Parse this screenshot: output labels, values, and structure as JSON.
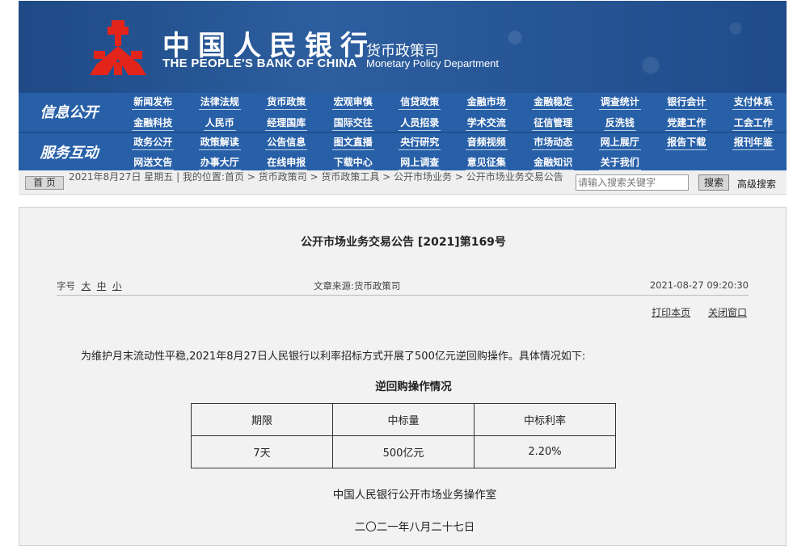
{
  "header": {
    "bank_name_cn": "中国人民银行",
    "bank_name_en": "THE PEOPLE'S BANK OF CHINA",
    "department_cn": "货币政策司",
    "department_en": "Monetary Policy Department",
    "logo_icon": "pboc-emblem-icon",
    "brand_color": "#e3241b",
    "banner_color": "#1e4a86"
  },
  "nav": {
    "section_info": "信息公开",
    "section_service": "服务互动",
    "row1": [
      "新闻发布",
      "法律法规",
      "货币政策",
      "宏观审慎",
      "信贷政策",
      "金融市场",
      "金融稳定",
      "调查统计",
      "银行会计",
      "支付体系"
    ],
    "row2": [
      "金融科技",
      "人民币",
      "经理国库",
      "国际交往",
      "人员招录",
      "学术交流",
      "征信管理",
      "反洗钱",
      "党建工作",
      "工会工作"
    ],
    "row3": [
      "政务公开",
      "政策解读",
      "公告信息",
      "图文直播",
      "央行研究",
      "音频视频",
      "市场动态",
      "网上展厅",
      "报告下载",
      "报刊年鉴"
    ],
    "row4": [
      "网送文告",
      "办事大厅",
      "在线申报",
      "下载中心",
      "网上调查",
      "意见征集",
      "金融知识",
      "关于我们"
    ]
  },
  "breadcrumb": {
    "home": "首 页",
    "text": "2021年8月27日 星期五 | 我的位置:首页 > 货币政策司 > 货币政策工具 > 公开市场业务 > 公开市场业务交易公告",
    "search_placeholder": "请输入搜索关键字",
    "search_button": "搜索",
    "advanced_search": "高级搜索"
  },
  "article": {
    "title": "公开市场业务交易公告 [2021]第169号",
    "font_size_label": "字号",
    "font_size_large": "大",
    "font_size_medium": "中",
    "font_size_small": "小",
    "source": "文章来源:货币政策司",
    "datetime": "2021-08-27 09:20:30",
    "print_link": "打印本页",
    "close_link": "关闭窗口",
    "body": "为维护月末流动性平稳,2021年8月27日人民银行以利率招标方式开展了500亿元逆回购操作。具体情况如下:",
    "table_title": "逆回购操作情况",
    "table_headers": [
      "期限",
      "中标量",
      "中标利率"
    ],
    "table_rows": [
      [
        "7天",
        "500亿元",
        "2.20%"
      ]
    ],
    "signature": "中国人民银行公开市场业务操作室",
    "date_cn": "二〇二一年八月二十七日"
  }
}
